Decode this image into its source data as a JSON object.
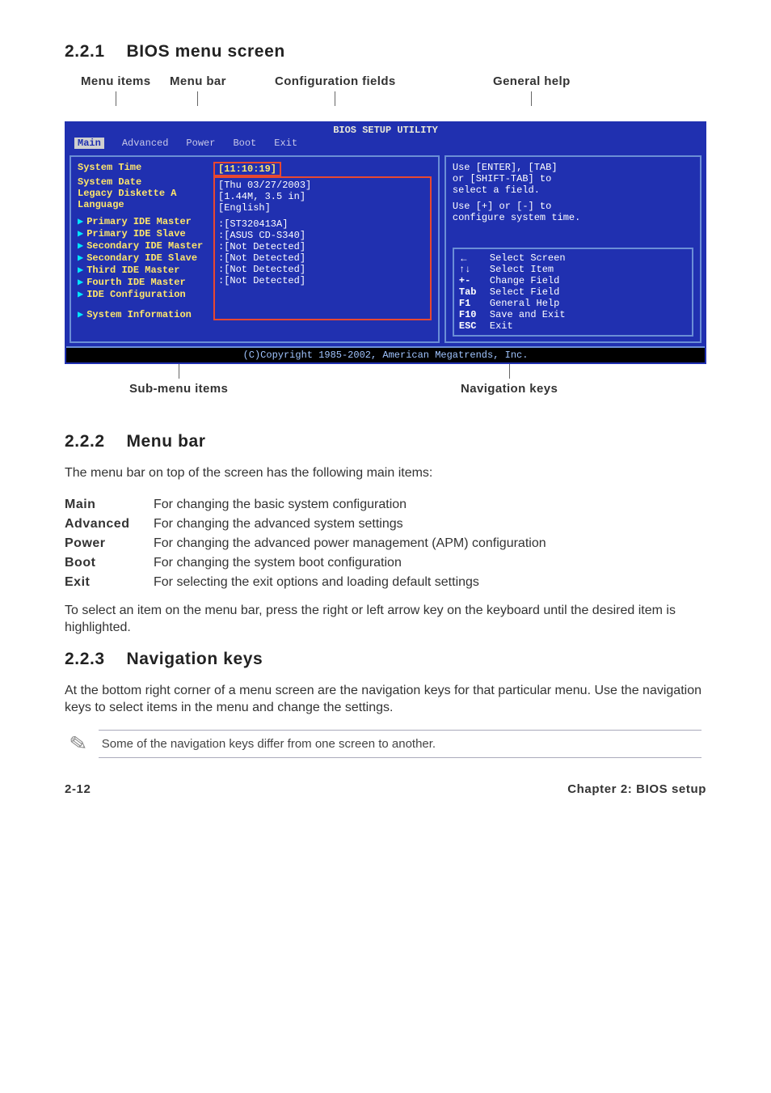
{
  "sections": {
    "s1": {
      "num": "2.2.1",
      "title": "BIOS menu screen"
    },
    "s2": {
      "num": "2.2.2",
      "title": "Menu bar"
    },
    "s3": {
      "num": "2.2.3",
      "title": "Navigation keys"
    }
  },
  "callouts": {
    "menuItems": "Menu items",
    "menuBar": "Menu bar",
    "configFields": "Configuration fields",
    "generalHelp": "General help",
    "subMenuItems": "Sub-menu items",
    "navKeys": "Navigation keys"
  },
  "bios": {
    "title": "BIOS SETUP UTILITY",
    "menubar": [
      "Main",
      "Advanced",
      "Power",
      "Boot",
      "Exit"
    ],
    "selectedTab": "Main",
    "left": {
      "rows": [
        {
          "k": "System Time",
          "v": "[11:10:19]",
          "hl": true
        },
        {
          "k": "System Date",
          "v": "[Thu 03/27/2003]"
        },
        {
          "k": "Legacy Diskette A",
          "v": "[1.44M, 3.5 in]"
        },
        {
          "k": "Language",
          "v": "[English]"
        }
      ],
      "subs": [
        {
          "k": "Primary IDE Master",
          "v": ":[ST320413A]"
        },
        {
          "k": "Primary IDE Slave",
          "v": ":[ASUS CD-S340]"
        },
        {
          "k": "Secondary IDE Master",
          "v": ":[Not Detected]"
        },
        {
          "k": "Secondary IDE Slave",
          "v": ":[Not Detected]"
        },
        {
          "k": "Third IDE Master",
          "v": ":[Not Detected]"
        },
        {
          "k": "Fourth IDE Master",
          "v": ":[Not Detected]"
        },
        {
          "k": "IDE Configuration",
          "v": ""
        }
      ],
      "sysInfo": "System Information"
    },
    "right": {
      "help1": "Use [ENTER], [TAB]",
      "help2": "or [SHIFT-TAB] to",
      "help3": "select a field.",
      "help4": "Use [+] or [-] to",
      "help5": "configure system time.",
      "nav": [
        {
          "key": "←",
          "txt": "Select Screen"
        },
        {
          "key": "↑↓",
          "txt": "Select Item"
        },
        {
          "key": "+-",
          "txt": "Change Field"
        },
        {
          "key": "Tab",
          "txt": "Select Field"
        },
        {
          "key": "F1",
          "txt": "General Help"
        },
        {
          "key": "F10",
          "txt": "Save and Exit"
        },
        {
          "key": "ESC",
          "txt": "Exit"
        }
      ]
    },
    "footer": "(C)Copyright 1985-2002, American Megatrends, Inc."
  },
  "menubarText": {
    "intro": "The menu bar on top of the screen has the following main items:",
    "items": [
      {
        "name": "Main",
        "desc": "For changing the basic system configuration"
      },
      {
        "name": "Advanced",
        "desc": "For changing the advanced system settings"
      },
      {
        "name": "Power",
        "desc": "For changing the advanced power management (APM) configuration"
      },
      {
        "name": "Boot",
        "desc": "For changing the system boot configuration"
      },
      {
        "name": "Exit",
        "desc": "For selecting the exit options and loading default settings"
      }
    ],
    "para": "To select an item on the menu bar, press the right or left arrow key on the keyboard until the desired item is highlighted."
  },
  "navText": {
    "para": "At the bottom right corner of a menu screen are the navigation keys for that particular menu. Use the navigation keys to select items in the menu and change the settings.",
    "note": "Some of the navigation keys differ from one screen to another."
  },
  "footer": {
    "left": "2-12",
    "right": "Chapter 2: BIOS setup"
  }
}
